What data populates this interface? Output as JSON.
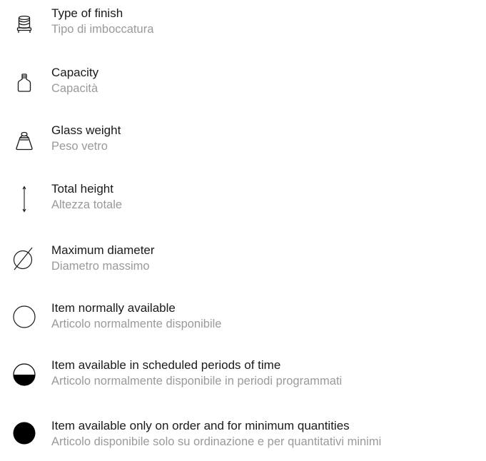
{
  "legend": {
    "items": [
      {
        "icon": "finish-icon",
        "label_en": "Type of finish",
        "label_it": "Tipo di imboccatura"
      },
      {
        "icon": "capacity-bottle-icon",
        "label_en": "Capacity",
        "label_it": "Capacità"
      },
      {
        "icon": "weight-icon",
        "label_en": "Glass weight",
        "label_it": "Peso vetro"
      },
      {
        "icon": "height-arrow-icon",
        "label_en": "Total height",
        "label_it": "Altezza totale"
      },
      {
        "icon": "diameter-icon",
        "label_en": "Maximum diameter",
        "label_it": "Diametro massimo"
      },
      {
        "icon": "empty-circle-icon",
        "label_en": "Item normally available",
        "label_it": "Articolo normalmente disponibile"
      },
      {
        "icon": "half-filled-circle-icon",
        "label_en": "Item available in scheduled periods of time",
        "label_it": "Articolo normalmente disponibile in periodi programmati"
      },
      {
        "icon": "filled-circle-icon",
        "label_en": "Item available only on order and for minimum quantities",
        "label_it": "Articolo disponibile solo su ordinazione e per quantitativi minimi"
      }
    ]
  }
}
